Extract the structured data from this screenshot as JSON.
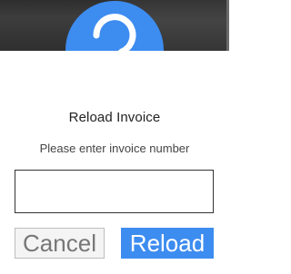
{
  "dialog": {
    "title": "Reload Invoice",
    "message": "Please enter invoice number",
    "badge_icon": "question-mark-icon",
    "accent_color": "#3d8cf0",
    "input": {
      "value": "",
      "placeholder": ""
    },
    "buttons": {
      "cancel_label": "Cancel",
      "reload_label": "Reload"
    }
  }
}
